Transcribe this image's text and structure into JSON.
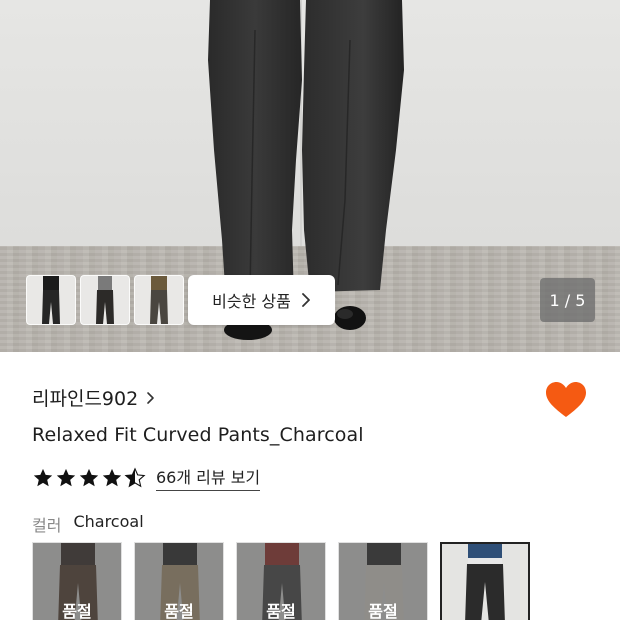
{
  "hero": {
    "counter": "1 / 5",
    "similar_button": {
      "label": "비슷한 상품",
      "icon": "chevron-right-icon"
    },
    "thumbnails": [
      {
        "name": "thumbnail-1",
        "pants_color": "#262626"
      },
      {
        "name": "thumbnail-2",
        "pants_color": "#2c2a28"
      },
      {
        "name": "thumbnail-3",
        "pants_color": "#4a4640"
      }
    ]
  },
  "product": {
    "brand": "리파인드902",
    "brand_chevron": "›",
    "title": "Relaxed Fit Curved Pants_Charcoal",
    "favorite": {
      "active": true,
      "color": "#f55a12"
    },
    "rating": {
      "value": 4.5,
      "max": 5,
      "review_link": "66개 리뷰 보기"
    }
  },
  "color_option": {
    "label": "컬러",
    "value": "Charcoal",
    "swatches": [
      {
        "name": "brown",
        "pants_color": "#5a4334",
        "top_color": "#3a2f2a",
        "sold_out": true,
        "selected": false
      },
      {
        "name": "beige",
        "pants_color": "#b7a17c",
        "top_color": "#2a2a2a",
        "sold_out": true,
        "selected": false
      },
      {
        "name": "gray",
        "pants_color": "#4a4a4a",
        "top_color": "#a0322a",
        "sold_out": true,
        "selected": false
      },
      {
        "name": "ivory",
        "pants_color": "#e8e4dc",
        "top_color": "#2e2e2e",
        "sold_out": true,
        "selected": false
      },
      {
        "name": "charcoal",
        "pants_color": "#2b2b2b",
        "top_color": "#2f4f77",
        "sold_out": false,
        "selected": true
      }
    ],
    "sold_out_label": "품절"
  }
}
